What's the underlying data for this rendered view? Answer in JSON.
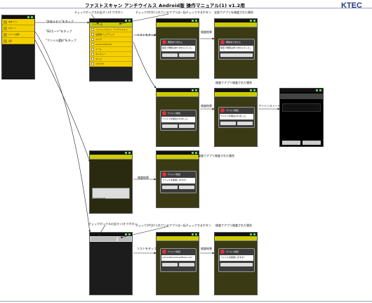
{
  "header": {
    "title": "ファストスキャン アンチウイルス Android版 操作マニュアル(1) v1.2用",
    "logo": "KTEC"
  },
  "labels": {
    "checkbox_toggle_top": "チェックボックスの全オン/オフボタン",
    "checked_all_scan_top": "チェックが付けられているアプリは一括チェックするボタン",
    "tap_home": "\"本体メモリ\"をタップ",
    "tap_sd": "\"SDカード\"をタップ",
    "tap_file": "\"ファイル選択\"をタップ",
    "tap_list_1": "リストをタップ",
    "scan_result_1": "検査結果",
    "target_found_1": "全部でアプリを検査された場合",
    "target_found_2": "検査でアプリ検査された場合",
    "scan_result_2": "検査結果",
    "uninstall": "アンインストール",
    "scan_result_3": "検査結果",
    "target_found_3": "検査でアプリ検査された場合",
    "checkbox_toggle_bottom": "チェックボックスの全オン/オフボタン",
    "checked_all_scan_bottom": "チェックが付けられているアプリは一括チェックするボタン",
    "tap_list_2": "リストをタップ",
    "scan_result_4": "検査結果",
    "target_found_4": "検査でアプリ検査された場合"
  },
  "home_menu": {
    "items": [
      "本体メモリ",
      "SDカード",
      "ファイル選択",
      "設定"
    ]
  },
  "app_list": {
    "title": "アプリ一覧",
    "items": [
      "ファストスキャン アンチウイルス",
      "電話帳バックアップ",
      "カメラ",
      "Android Market",
      "メール",
      "ギャラリー",
      "マップ",
      "ブラウザ"
    ]
  },
  "dialogs": {
    "safe_title": "問題ありません",
    "safe_body": "検査で問題はありませんでした。",
    "virus_title": "ウイルス検出",
    "virus_body": "ウイルスが検出されました。",
    "delete_prompt": "ファイルを削除しますか?",
    "ok": "OK",
    "cancel": "キャンセル"
  },
  "sd_panel": {
    "path": "/mnt/sdcard",
    "file_name": "/sdcard/Download/Eicar.com"
  },
  "colors": {
    "accent_yellow": "#f5d000",
    "title_bar": "#cccc00",
    "dialog_bg": "#3c3c3c"
  }
}
